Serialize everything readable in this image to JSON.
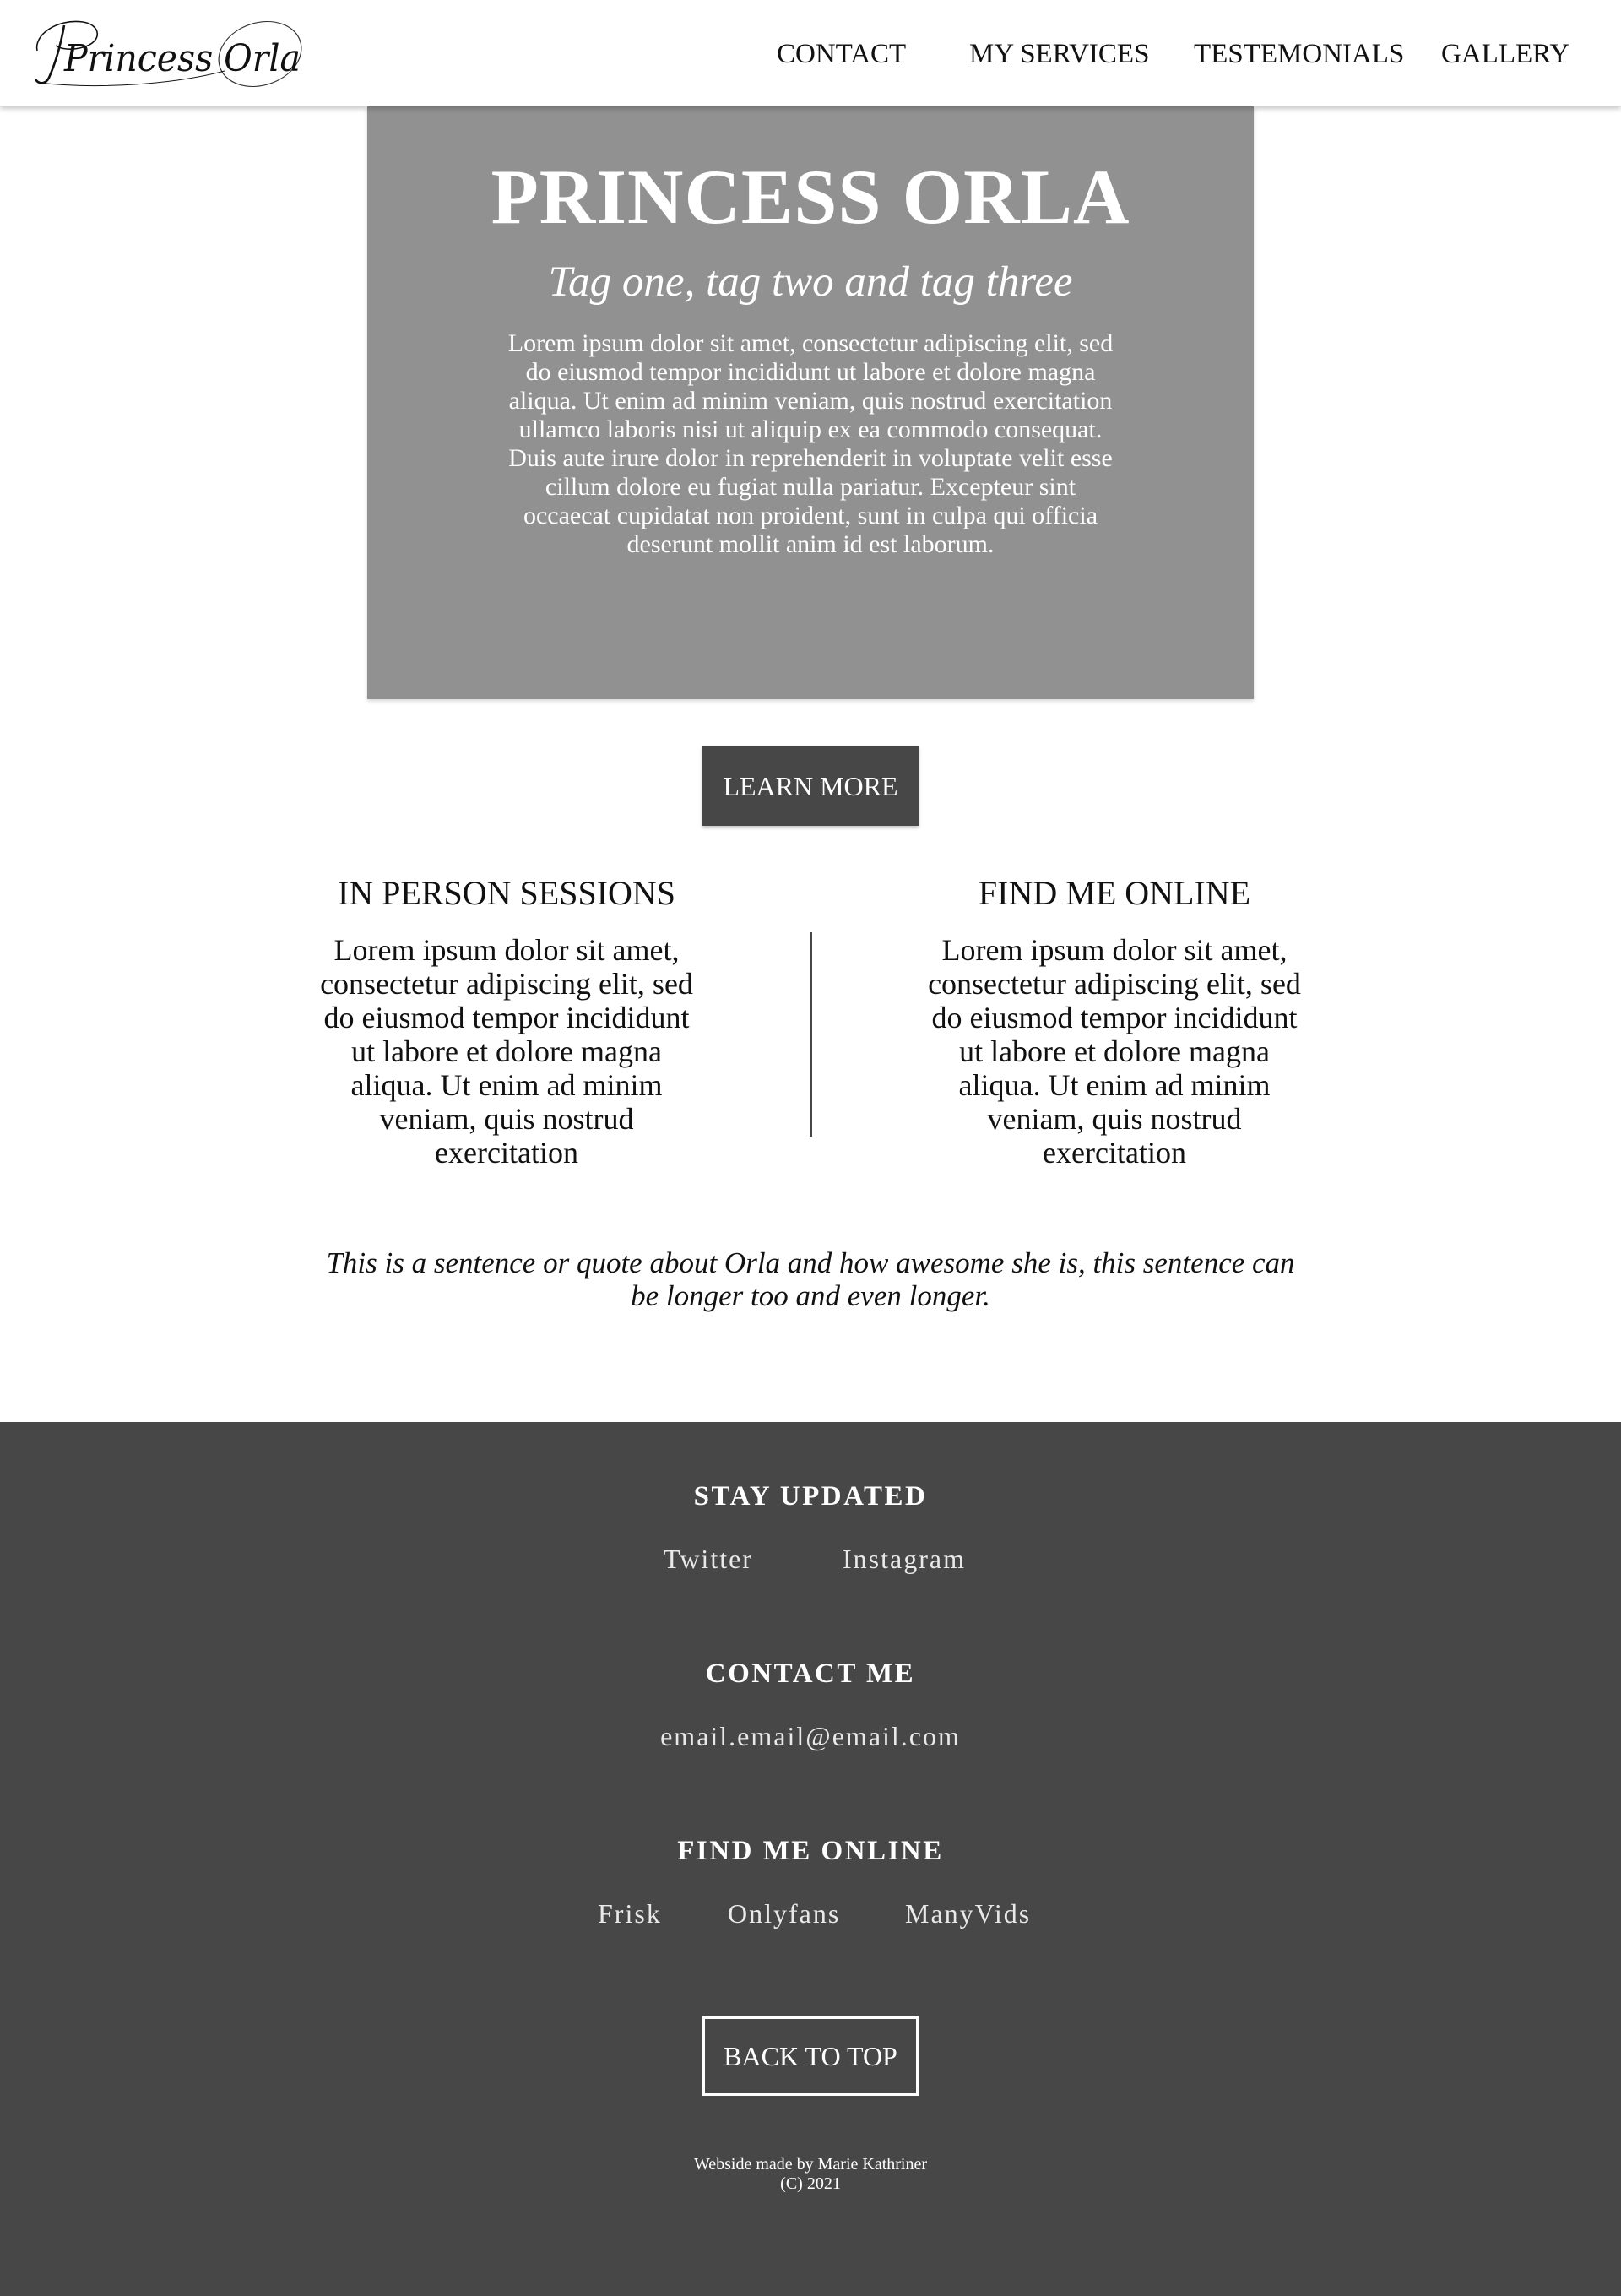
{
  "brand": {
    "logo_text": "Princess Orla"
  },
  "nav": {
    "links": [
      {
        "label": "CONTACT"
      },
      {
        "label": "MY SERVICES"
      },
      {
        "label": "TESTEMONIALS"
      },
      {
        "label": "GALLERY"
      }
    ]
  },
  "hero": {
    "title": "PRINCESS ORLA",
    "tagline": "Tag one, tag two and tag three",
    "body": "Lorem ipsum dolor sit amet, consectetur adipiscing elit, sed do eiusmod tempor incididunt ut labore et dolore magna aliqua. Ut enim ad minim veniam, quis nostrud exercitation ullamco laboris nisi ut aliquip ex ea commodo consequat. Duis aute irure dolor in reprehenderit in voluptate velit esse cillum dolore eu fugiat nulla pariatur. Excepteur sint occaecat cupidatat non proident, sunt in culpa qui officia deserunt mollit anim id est laborum.",
    "background_color": "#919191"
  },
  "cta": {
    "learn_more_label": "LEARN MORE"
  },
  "columns": {
    "left": {
      "heading": "IN PERSON SESSIONS",
      "body": "Lorem ipsum dolor sit amet, consectetur adipiscing elit, sed do eiusmod tempor incididunt ut labore et dolore magna aliqua. Ut enim ad minim veniam, quis nostrud exercitation"
    },
    "right": {
      "heading": "FIND ME ONLINE",
      "body": "Lorem ipsum dolor sit amet, consectetur adipiscing elit, sed do eiusmod tempor incididunt ut labore et dolore magna aliqua. Ut enim ad minim veniam, quis nostrud exercitation"
    }
  },
  "quote": {
    "text": "This is a sentence or quote about Orla and how awesome she is, this sentence can be longer too and even longer."
  },
  "footer": {
    "background_color": "#474747",
    "stay_updated": {
      "heading": "STAY UPDATED",
      "links": [
        {
          "label": "Twitter"
        },
        {
          "label": "Instagram"
        }
      ]
    },
    "contact": {
      "heading": "CONTACT ME",
      "email": "email.email@email.com"
    },
    "find_online": {
      "heading": "FIND ME ONLINE",
      "links": [
        {
          "label": "Frisk"
        },
        {
          "label": "Onlyfans"
        },
        {
          "label": "ManyVids"
        }
      ]
    },
    "back_to_top_label": "BACK TO TOP",
    "credits": {
      "line1": "Webside made by Marie Kathriner",
      "line2": "(C) 2021"
    }
  }
}
